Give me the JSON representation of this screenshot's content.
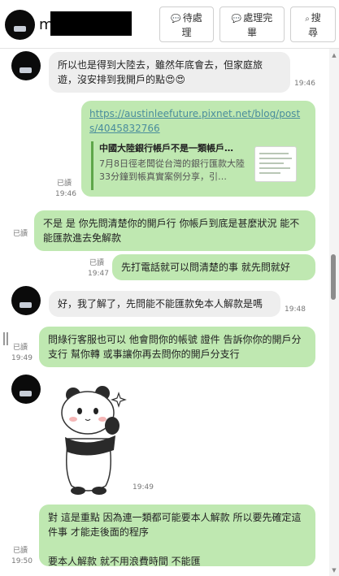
{
  "header": {
    "contact_name": "m",
    "buttons": {
      "pending": "待處理",
      "done": "處理完畢",
      "search": "搜尋"
    },
    "icons": {
      "pending": "speech-bubble-icon",
      "done": "check-bubble-icon",
      "search": "search-icon"
    }
  },
  "messages": [
    {
      "dir": "in",
      "text": "所以也是得到大陸去，雖然年底會去，但家庭旅遊，沒安排到我開戶的點😍😍",
      "time": "19:46"
    },
    {
      "dir": "out",
      "link": "https://austinleefuture.pixnet.net/blog/posts/4045832766",
      "preview_title": "中國大陸銀行帳戶不是一類帳戶…",
      "preview_desc": "7月8日徑老闆從台灣的銀行匯款大陸 33分鐘到帳真實案例分享，引…",
      "read": "已讀",
      "time": "19:46"
    },
    {
      "dir": "out",
      "text": "不是 是 你先問清楚你的開戶行 你帳戶到底是甚麼狀況 能不能匯款進去免解款",
      "read": "已讀",
      "time": ""
    },
    {
      "dir": "out",
      "text": "先打電話就可以問清楚的事 就先問就好",
      "read": "已讀",
      "time": "19:47"
    },
    {
      "dir": "in",
      "text": "好，我了解了，先問能不能匯款免本人解款是嗎",
      "time": "19:48"
    },
    {
      "dir": "out",
      "text": "問綠行客服也可以 他會問你的帳號 證件 告訴你你的開戶分支行 幫你轉 或事讓你再去問你的開戶分支行",
      "read": "已讀",
      "time": "19:49"
    },
    {
      "dir": "in",
      "sticker": "panda-sticker",
      "time": "19:49"
    },
    {
      "dir": "out",
      "text": "對 這是重點 因為連一類都可能要本人解款 所以要先確定這件事 才能走後面的程序\n\n要本人解款 就不用浪費時間 不能匯",
      "read": "已讀",
      "time": "19:50"
    }
  ]
}
